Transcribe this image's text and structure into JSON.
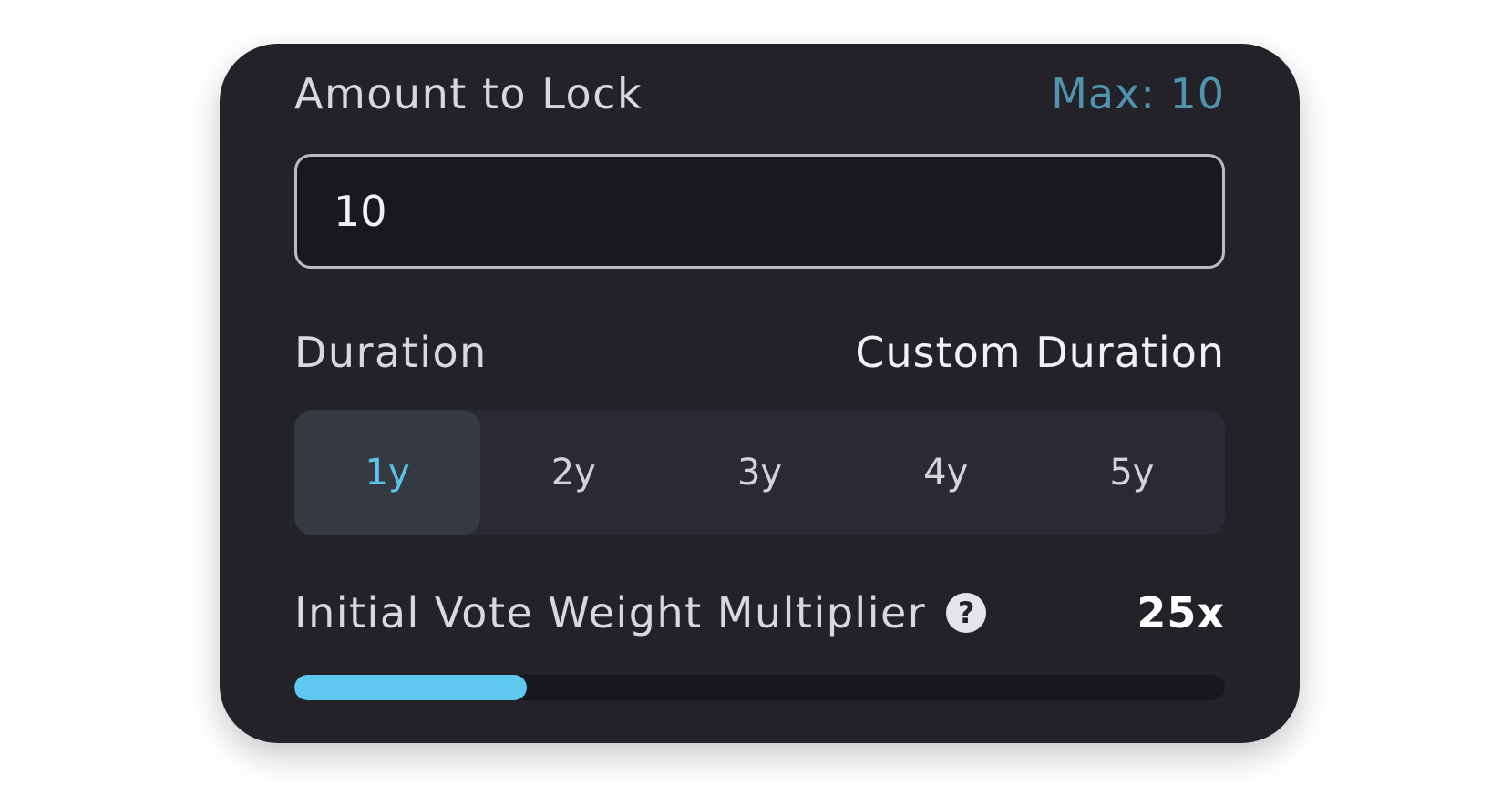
{
  "amount": {
    "label": "Amount to Lock",
    "max_label": "Max: 10",
    "value": "10"
  },
  "duration": {
    "label": "Duration",
    "custom_label": "Custom Duration",
    "options": [
      "1y",
      "2y",
      "3y",
      "4y",
      "5y"
    ],
    "selected": "1y"
  },
  "multiplier": {
    "label": "Initial Vote Weight Multiplier",
    "help_icon": "question-circle-icon",
    "value": "25x",
    "progress_fraction": 0.25
  },
  "colors": {
    "accent": "#5ec8ee",
    "max_label": "#4f93ae",
    "card_background": "#222228"
  }
}
